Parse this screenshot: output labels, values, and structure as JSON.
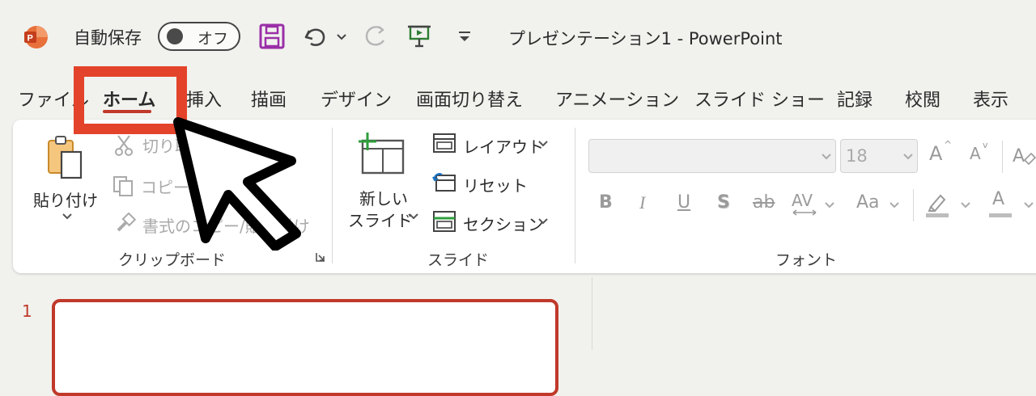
{
  "titlebar": {
    "autosave_label": "自動保存",
    "autosave_state": "オフ",
    "document_title": "プレゼンテーション1 - PowerPoint",
    "accent_color": "#c0392b"
  },
  "tabs": [
    {
      "label": "ファイル"
    },
    {
      "label": "ホーム",
      "active": true
    },
    {
      "label": "挿入"
    },
    {
      "label": "描画"
    },
    {
      "label": "デザイン"
    },
    {
      "label": "画面切り替え"
    },
    {
      "label": "アニメーション"
    },
    {
      "label": "スライド ショー"
    },
    {
      "label": "記録"
    },
    {
      "label": "校閲"
    },
    {
      "label": "表示"
    }
  ],
  "ribbon": {
    "clipboard": {
      "paste_label": "貼り付け",
      "cut_label": "切り取",
      "copy_label": "コピー",
      "format_painter_label": "書式のコピー/貼り付け",
      "group_label": "クリップボード"
    },
    "slides": {
      "new_slide_line1": "新しい",
      "new_slide_line2": "スライド",
      "layout_label": "レイアウト",
      "reset_label": "リセット",
      "section_label": "セクション",
      "group_label": "スライド"
    },
    "font": {
      "font_name": "",
      "font_size": "18",
      "group_label": "フォント",
      "bold": "B",
      "italic": "I",
      "underline": "U",
      "shadow": "S",
      "strike": "ab",
      "spacing": "AV",
      "case": "Aa",
      "grow": "A",
      "shrink": "A",
      "font_color": "A"
    }
  },
  "thumbnails": {
    "slide_number": "1"
  },
  "annotation": {
    "highlight_color": "#e3432a"
  }
}
